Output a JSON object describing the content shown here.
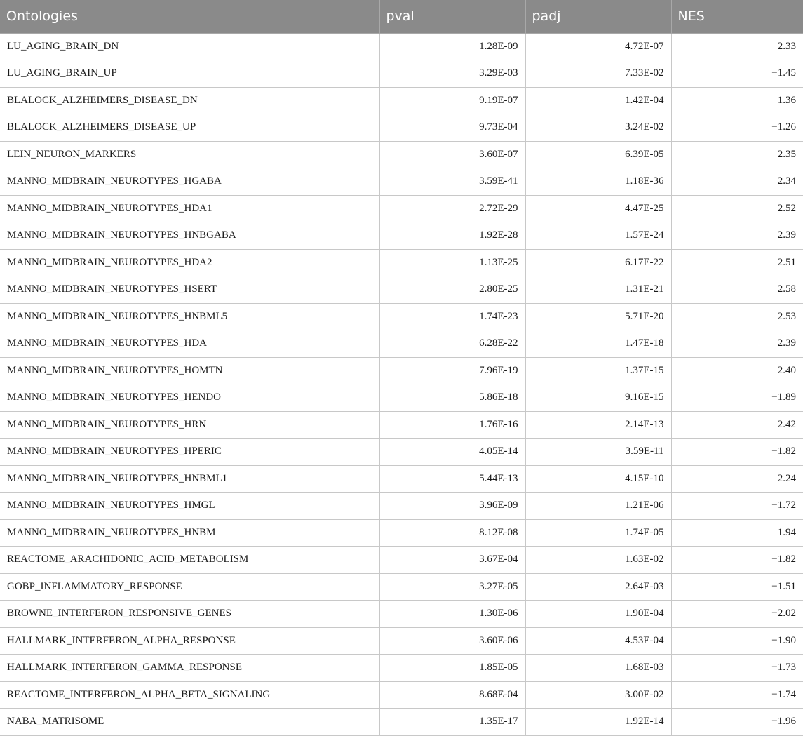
{
  "table": {
    "headers": [
      "Ontologies",
      "pval",
      "padj",
      "NES"
    ],
    "rows": [
      [
        "LU_AGING_BRAIN_DN",
        "1.28E-09",
        "4.72E-07",
        "2.33"
      ],
      [
        "LU_AGING_BRAIN_UP",
        "3.29E-03",
        "7.33E-02",
        "−1.45"
      ],
      [
        "BLALOCK_ALZHEIMERS_DISEASE_DN",
        "9.19E-07",
        "1.42E-04",
        "1.36"
      ],
      [
        "BLALOCK_ALZHEIMERS_DISEASE_UP",
        "9.73E-04",
        "3.24E-02",
        "−1.26"
      ],
      [
        "LEIN_NEURON_MARKERS",
        "3.60E-07",
        "6.39E-05",
        "2.35"
      ],
      [
        "MANNO_MIDBRAIN_NEUROTYPES_HGABA",
        "3.59E-41",
        "1.18E-36",
        "2.34"
      ],
      [
        "MANNO_MIDBRAIN_NEUROTYPES_HDA1",
        "2.72E-29",
        "4.47E-25",
        "2.52"
      ],
      [
        "MANNO_MIDBRAIN_NEUROTYPES_HNBGABA",
        "1.92E-28",
        "1.57E-24",
        "2.39"
      ],
      [
        "MANNO_MIDBRAIN_NEUROTYPES_HDA2",
        "1.13E-25",
        "6.17E-22",
        "2.51"
      ],
      [
        "MANNO_MIDBRAIN_NEUROTYPES_HSERT",
        "2.80E-25",
        "1.31E-21",
        "2.58"
      ],
      [
        "MANNO_MIDBRAIN_NEUROTYPES_HNBML5",
        "1.74E-23",
        "5.71E-20",
        "2.53"
      ],
      [
        "MANNO_MIDBRAIN_NEUROTYPES_HDA",
        "6.28E-22",
        "1.47E-18",
        "2.39"
      ],
      [
        "MANNO_MIDBRAIN_NEUROTYPES_HOMTN",
        "7.96E-19",
        "1.37E-15",
        "2.40"
      ],
      [
        "MANNO_MIDBRAIN_NEUROTYPES_HENDO",
        "5.86E-18",
        "9.16E-15",
        "−1.89"
      ],
      [
        "MANNO_MIDBRAIN_NEUROTYPES_HRN",
        "1.76E-16",
        "2.14E-13",
        "2.42"
      ],
      [
        "MANNO_MIDBRAIN_NEUROTYPES_HPERIC",
        "4.05E-14",
        "3.59E-11",
        "−1.82"
      ],
      [
        "MANNO_MIDBRAIN_NEUROTYPES_HNBML1",
        "5.44E-13",
        "4.15E-10",
        "2.24"
      ],
      [
        "MANNO_MIDBRAIN_NEUROTYPES_HMGL",
        "3.96E-09",
        "1.21E-06",
        "−1.72"
      ],
      [
        "MANNO_MIDBRAIN_NEUROTYPES_HNBM",
        "8.12E-08",
        "1.74E-05",
        "1.94"
      ],
      [
        "REACTOME_ARACHIDONIC_ACID_METABOLISM",
        "3.67E-04",
        "1.63E-02",
        "−1.82"
      ],
      [
        "GOBP_INFLAMMATORY_RESPONSE",
        "3.27E-05",
        "2.64E-03",
        "−1.51"
      ],
      [
        "BROWNE_INTERFERON_RESPONSIVE_GENES",
        "1.30E-06",
        "1.90E-04",
        "−2.02"
      ],
      [
        "HALLMARK_INTERFERON_ALPHA_RESPONSE",
        "3.60E-06",
        "4.53E-04",
        "−1.90"
      ],
      [
        "HALLMARK_INTERFERON_GAMMA_RESPONSE",
        "1.85E-05",
        "1.68E-03",
        "−1.73"
      ],
      [
        "REACTOME_INTERFERON_ALPHA_BETA_SIGNALING",
        "8.68E-04",
        "3.00E-02",
        "−1.74"
      ],
      [
        "NABA_MATRISOME",
        "1.35E-17",
        "1.92E-14",
        "−1.96"
      ]
    ]
  }
}
